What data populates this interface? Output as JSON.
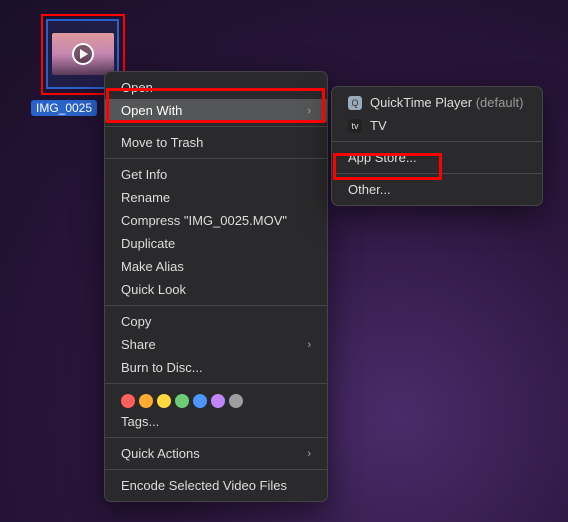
{
  "file": {
    "name": "IMG_0025"
  },
  "menu": {
    "open": "Open",
    "open_with": "Open With",
    "move_to_trash": "Move to Trash",
    "get_info": "Get Info",
    "rename": "Rename",
    "compress": "Compress \"IMG_0025.MOV\"",
    "duplicate": "Duplicate",
    "make_alias": "Make Alias",
    "quick_look": "Quick Look",
    "copy": "Copy",
    "share": "Share",
    "burn": "Burn to Disc...",
    "tags": "Tags...",
    "quick_actions": "Quick Actions",
    "encode": "Encode Selected Video Files"
  },
  "submenu": {
    "quicktime": "QuickTime Player",
    "quicktime_suffix": " (default)",
    "tv": "TV",
    "app_store": "App Store...",
    "other": "Other..."
  }
}
